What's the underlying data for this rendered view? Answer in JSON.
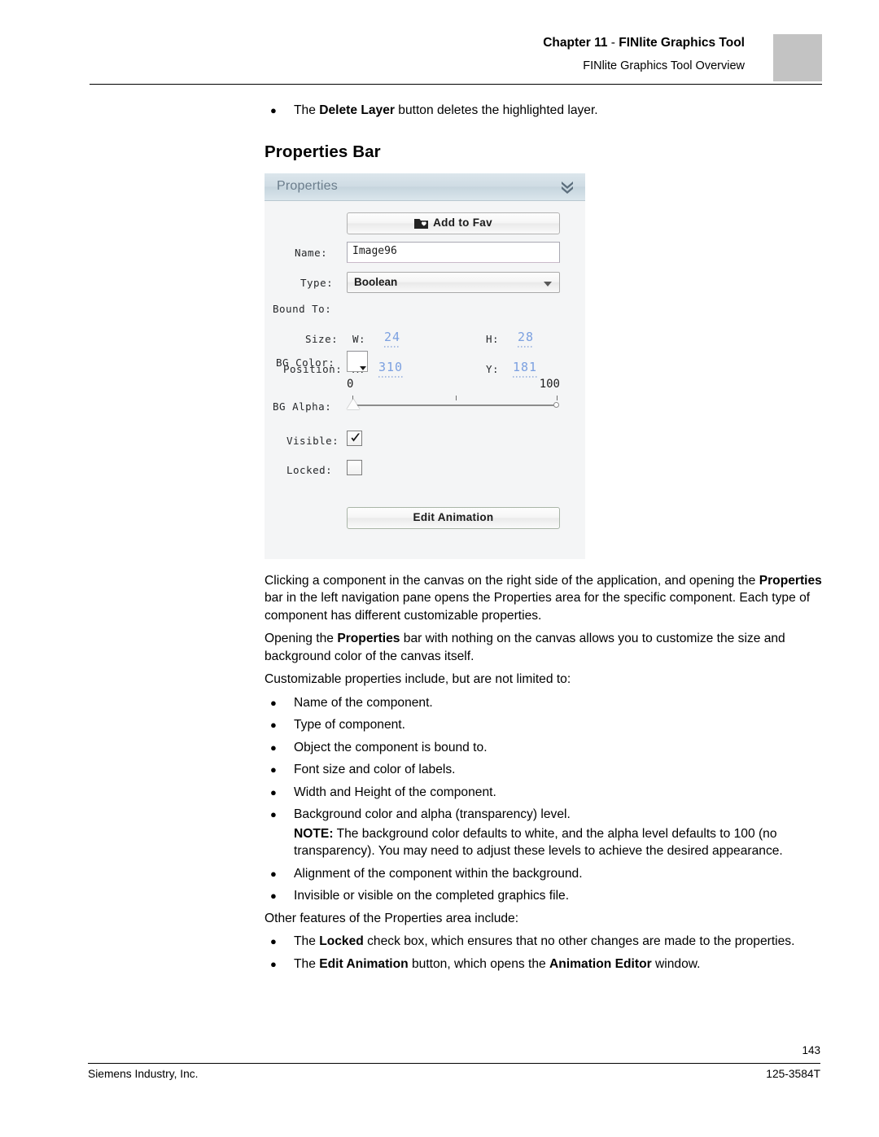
{
  "header": {
    "chapter_label": "Chapter 11",
    "chapter_sep": " - ",
    "chapter_title": "FINlite Graphics Tool",
    "subtitle": "FINlite Graphics Tool Overview"
  },
  "intro_bullet": {
    "prefix": "The ",
    "bold": "Delete Layer",
    "suffix": " button deletes the highlighted layer."
  },
  "section_title": "Properties Bar",
  "figure": {
    "panel_title": "Properties",
    "collapse_icon": "double-chevron-down-icon",
    "add_to_fav_label": "Add to Fav",
    "add_to_fav_icon": "folder-heart-icon",
    "name_label": "Name:",
    "name_value": "Image96",
    "type_label": "Type:",
    "type_value": "Boolean",
    "bound_to_label": "Bound To:",
    "size_label": "Size:",
    "size_w_label": "W:",
    "size_w_value": "24",
    "size_h_label": "H:",
    "size_h_value": "28",
    "position_label": "Position:",
    "position_x_label": "X:",
    "position_x_value": "310",
    "position_y_label": "Y:",
    "position_y_value": "181",
    "bg_color_label": "BG Color:",
    "bg_color_value": "#ffffff",
    "bg_alpha_label": "BG Alpha:",
    "bg_alpha_min": "0",
    "bg_alpha_max": "100",
    "bg_alpha_current": 0,
    "visible_label": "Visible:",
    "visible_checked": true,
    "locked_label": "Locked:",
    "locked_checked": false,
    "edit_animation_label": "Edit Animation"
  },
  "paragraphs": {
    "p1_a": "Clicking a component in the canvas on the right side of the application, and opening the ",
    "p1_b": "Properties",
    "p1_c": " bar in the left navigation pane opens the Properties area for the specific component. Each type of component has different customizable properties.",
    "p2_a": "Opening the ",
    "p2_b": "Properties",
    "p2_c": " bar with nothing on the canvas allows you to customize the size and background color of the canvas itself.",
    "p3": "Customizable properties include, but are not limited to:",
    "p4": "Other features of the Properties area include:"
  },
  "list_one": [
    "Name of the component.",
    "Type of component.",
    "Object the component is bound to.",
    "Font size and color of labels.",
    "Width and Height of the component.",
    "Background color and alpha (transparency) level."
  ],
  "note": {
    "bold": "NOTE:",
    "text": " The background color defaults to white, and the alpha level defaults to 100 (no transparency). You may need to adjust these levels to achieve the desired appearance."
  },
  "list_two": [
    "Alignment of the component within the background.",
    "Invisible or visible on the completed graphics file."
  ],
  "list_three": [
    {
      "prefix": "The ",
      "bold": "Locked",
      "suffix": " check box, which ensures that no other changes are made to the properties."
    },
    {
      "prefix": "The ",
      "bold": "Edit Animation",
      "mid": " button, which opens the ",
      "bold2": "Animation Editor",
      "suffix": " window."
    }
  ],
  "footer": {
    "page_number": "143",
    "company": "Siemens Industry, Inc.",
    "doc_number": "125-3584T"
  }
}
